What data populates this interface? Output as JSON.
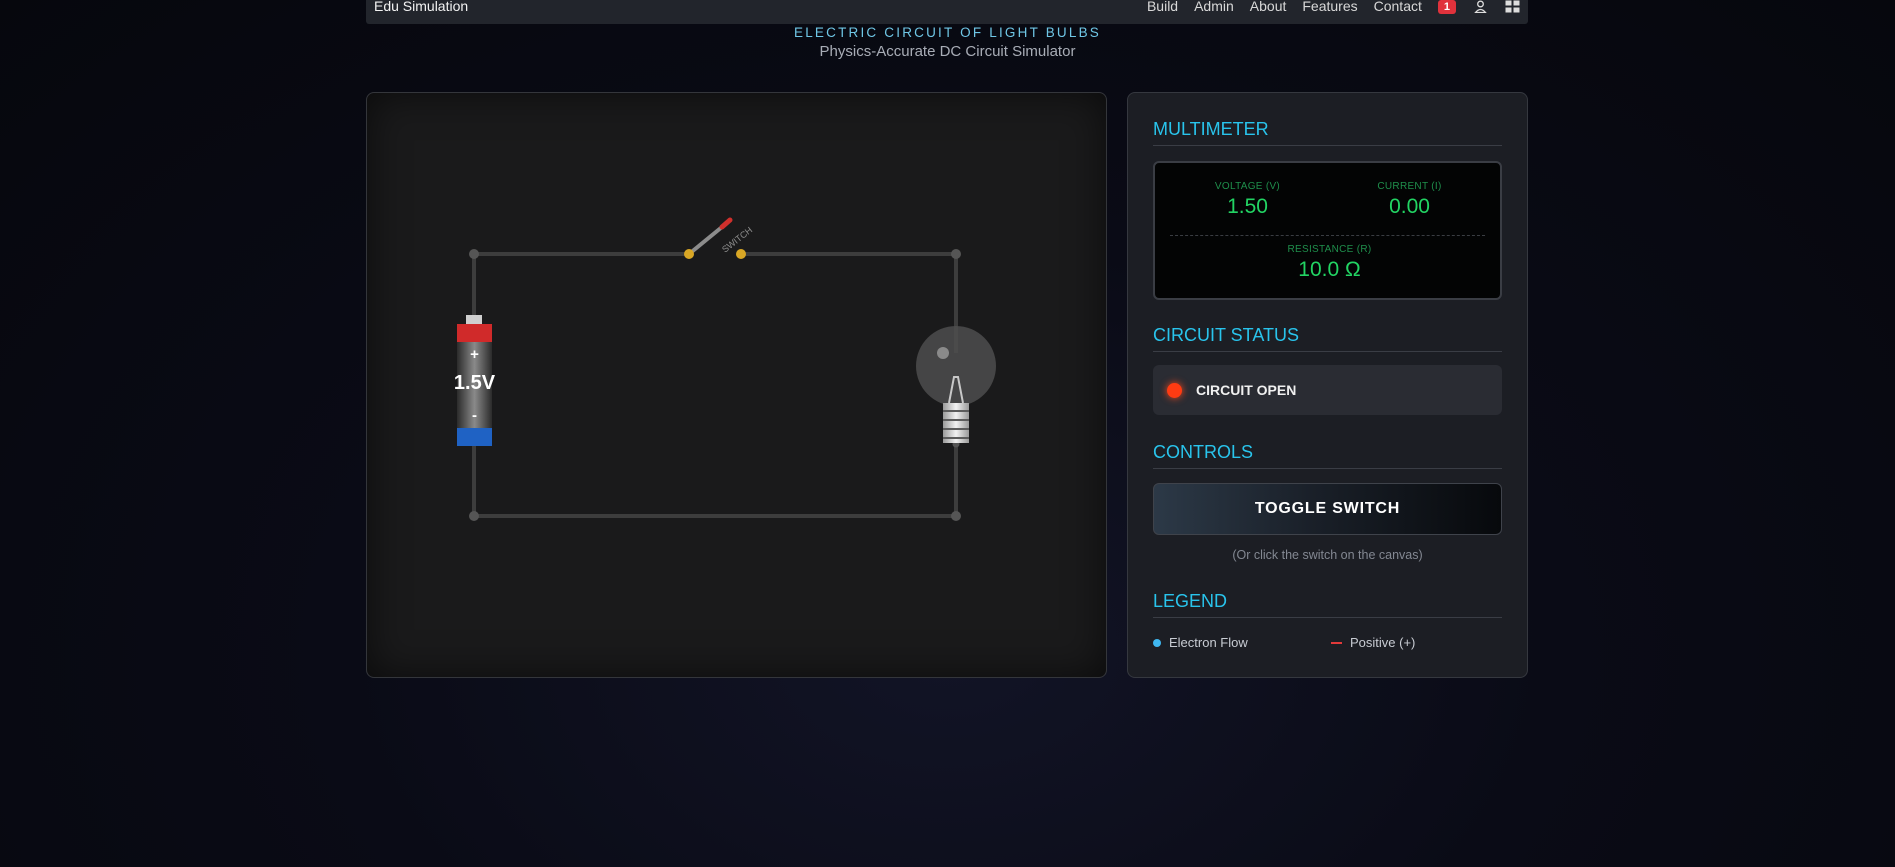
{
  "nav": {
    "brand": "Edu Simulation",
    "links": [
      "Build",
      "Admin",
      "About",
      "Features",
      "Contact"
    ],
    "notification_count": "1",
    "icons": [
      "user-icon",
      "grid-icon"
    ]
  },
  "header": {
    "title": "ELECTRIC CIRCUIT OF LIGHT BULBS",
    "subtitle": "Physics-Accurate DC Circuit Simulator"
  },
  "circuit": {
    "battery_label": "1.5V",
    "battery_plus": "+",
    "battery_minus": "-",
    "switch_label": "SWITCH",
    "switch_state": "open",
    "bulb_state": "off"
  },
  "multimeter": {
    "title": "MULTIMETER",
    "voltage_label": "VOLTAGE (V)",
    "voltage_value": "1.50",
    "current_label": "CURRENT (I)",
    "current_value": "0.00",
    "resistance_label": "RESISTANCE (R)",
    "resistance_value": "10.0 Ω"
  },
  "status": {
    "title": "CIRCUIT STATUS",
    "text": "CIRCUIT OPEN",
    "color": "#ff3b12"
  },
  "controls": {
    "title": "CONTROLS",
    "toggle_label": "TOGGLE SWITCH",
    "hint": "(Or click the switch on the canvas)"
  },
  "legend": {
    "title": "LEGEND",
    "items": [
      {
        "label": "Electron Flow",
        "color": "#3fb7f0"
      },
      {
        "label": "Positive (+)",
        "color": "#e23a3a"
      }
    ]
  },
  "colors": {
    "accent": "#29c4ec",
    "meter_text": "#22d463"
  }
}
